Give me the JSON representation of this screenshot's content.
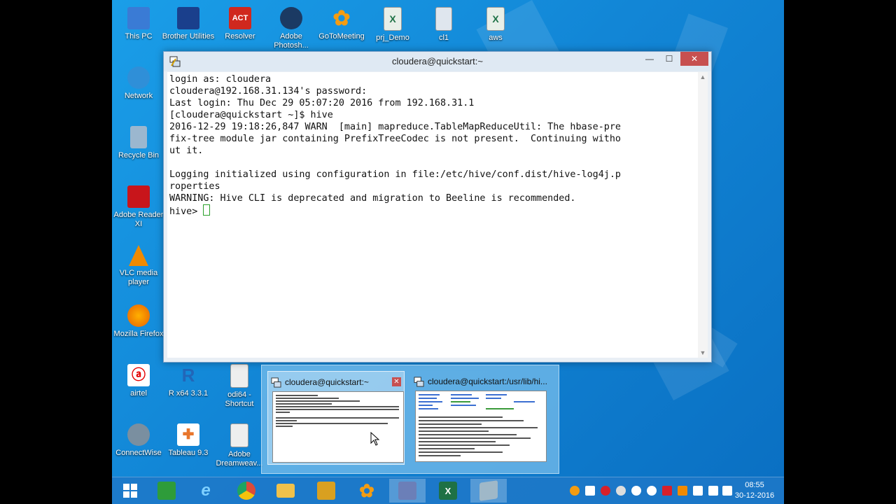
{
  "desktop_icons": [
    {
      "label": "This PC",
      "icon": "computer-icon",
      "color": "#3a7bd5"
    },
    {
      "label": "Network",
      "icon": "network-icon",
      "color": "#2f8fd8"
    },
    {
      "label": "Recycle Bin",
      "icon": "recycle-bin-icon",
      "color": "#9bb7cf"
    },
    {
      "label": "Adobe Reader XI",
      "icon": "adobe-reader-icon",
      "color": "#c8151b"
    },
    {
      "label": "VLC media player",
      "icon": "vlc-icon",
      "color": "#f08a00"
    },
    {
      "label": "Mozilla Firefox",
      "icon": "firefox-icon",
      "color": "#e66000"
    },
    {
      "label": "airtel",
      "icon": "airtel-icon",
      "color": "#e40000"
    },
    {
      "label": "ConnectWise",
      "icon": "connectwise-icon",
      "color": "#7a8fa0"
    },
    {
      "label": "Brother Utilities",
      "icon": "brother-utilities-icon",
      "color": "#1a3f8c"
    },
    {
      "label": "Resolver",
      "icon": "resolver-icon",
      "color": "#d0281e"
    },
    {
      "label": "Adobe Photosh...",
      "icon": "photoshop-icon",
      "color": "#1b3a63"
    },
    {
      "label": "GoToMeeting",
      "icon": "gotomeeting-icon",
      "color": "#f39c12"
    },
    {
      "label": "prj_Demo",
      "icon": "excel-file-icon",
      "color": "#1e7145"
    },
    {
      "label": "cl1",
      "icon": "file-icon",
      "color": "#dfe6ee"
    },
    {
      "label": "aws",
      "icon": "excel-file-icon",
      "color": "#1e7145"
    },
    {
      "label": "R x64 3.3.1",
      "icon": "r-icon",
      "color": "#2266b8"
    },
    {
      "label": "Tableau 9.3",
      "icon": "tableau-icon",
      "color": "#e8762c"
    },
    {
      "label": "odi64 - Shortcut",
      "icon": "odi-icon",
      "color": "#c0392b"
    },
    {
      "label": "Adobe Dreamweav...",
      "icon": "dreamweaver-icon",
      "color": "#35a845"
    }
  ],
  "putty": {
    "title": "cloudera@quickstart:~",
    "lines": [
      "login as: cloudera",
      "cloudera@192.168.31.134's password:",
      "Last login: Thu Dec 29 05:07:20 2016 from 192.168.31.1",
      "[cloudera@quickstart ~]$ hive",
      "2016-12-29 19:18:26,847 WARN  [main] mapreduce.TableMapReduceUtil: The hbase-pre",
      "fix-tree module jar containing PrefixTreeCodec is not present.  Continuing witho",
      "ut it.",
      "",
      "Logging initialized using configuration in file:/etc/hive/conf.dist/hive-log4j.p",
      "roperties",
      "WARNING: Hive CLI is deprecated and migration to Beeline is recommended."
    ],
    "prompt": "hive> "
  },
  "thumbnails": [
    {
      "title": "cloudera@quickstart:~",
      "hover": true
    },
    {
      "title": "cloudera@quickstart:/usr/lib/hi...",
      "hover": false
    }
  ],
  "taskbar": {
    "apps": [
      {
        "name": "start-button",
        "label": "",
        "color": "#1f7ad0"
      },
      {
        "name": "store-app",
        "label": "",
        "color": "#2e9c3a"
      },
      {
        "name": "internet-explorer-app",
        "label": "e",
        "color": "#1f8fe0"
      },
      {
        "name": "chrome-app",
        "label": "",
        "color": "#dd4b39"
      },
      {
        "name": "file-explorer-app",
        "label": "",
        "color": "#f0c14b"
      },
      {
        "name": "network-tool-app",
        "label": "",
        "color": "#d9a020"
      },
      {
        "name": "gotomeeting-app",
        "label": "",
        "color": "#f39c12"
      },
      {
        "name": "putty-app",
        "label": "",
        "color": "#6b7fb8"
      },
      {
        "name": "excel-app",
        "label": "X",
        "color": "#1e7145"
      },
      {
        "name": "notes-app",
        "label": "",
        "color": "#9fb8c8"
      }
    ],
    "clock": {
      "time": "08:55",
      "date": "30-12-2016"
    }
  }
}
